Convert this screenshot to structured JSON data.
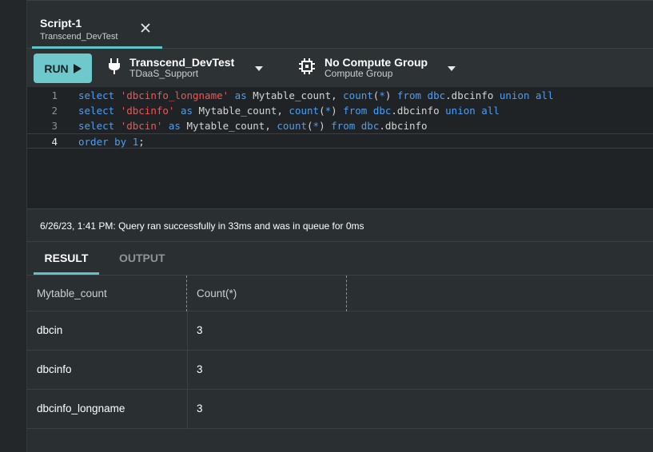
{
  "tab": {
    "title": "Script-1",
    "subtitle": "Transcend_DevTest",
    "close_icon": "close-icon"
  },
  "toolbar": {
    "run_label": "RUN",
    "connection": {
      "name": "Transcend_DevTest",
      "sub": "TDaaS_Support",
      "icon": "plug-icon"
    },
    "compute": {
      "name": "No Compute Group",
      "sub": "Compute Group",
      "icon": "chip-icon"
    }
  },
  "editor": {
    "lines": [
      {
        "num": "1",
        "tokens": [
          [
            "kw",
            "select "
          ],
          [
            "str",
            "'dbcinfo_longname'"
          ],
          [
            "kw",
            " as "
          ],
          [
            "plain",
            "Mytable_count, "
          ],
          [
            "kw",
            "count"
          ],
          [
            "plain",
            "("
          ],
          [
            "kw",
            "*"
          ],
          [
            "plain",
            ") "
          ],
          [
            "kw",
            "from "
          ],
          [
            "kw",
            "dbc"
          ],
          [
            "plain",
            ".dbcinfo "
          ],
          [
            "kw",
            "union all"
          ]
        ]
      },
      {
        "num": "2",
        "tokens": [
          [
            "kw",
            "select "
          ],
          [
            "str",
            "'dbcinfo'"
          ],
          [
            "kw",
            " as "
          ],
          [
            "plain",
            "Mytable_count, "
          ],
          [
            "kw",
            "count"
          ],
          [
            "plain",
            "("
          ],
          [
            "kw",
            "*"
          ],
          [
            "plain",
            ") "
          ],
          [
            "kw",
            "from "
          ],
          [
            "kw",
            "dbc"
          ],
          [
            "plain",
            ".dbcinfo "
          ],
          [
            "kw",
            "union all"
          ]
        ]
      },
      {
        "num": "3",
        "tokens": [
          [
            "kw",
            "select "
          ],
          [
            "str",
            "'dbcin'"
          ],
          [
            "kw",
            " as "
          ],
          [
            "plain",
            "Mytable_count, "
          ],
          [
            "kw",
            "count"
          ],
          [
            "plain",
            "("
          ],
          [
            "kw",
            "*"
          ],
          [
            "plain",
            ") "
          ],
          [
            "kw",
            "from "
          ],
          [
            "kw",
            "dbc"
          ],
          [
            "plain",
            ".dbcinfo"
          ]
        ]
      },
      {
        "num": "4",
        "tokens": [
          [
            "kw",
            "order by "
          ],
          [
            "kw",
            "1"
          ],
          [
            "plain",
            ";"
          ]
        ]
      }
    ]
  },
  "status": {
    "message": "6/26/23, 1:41 PM: Query ran successfully in 33ms and was in queue for 0ms"
  },
  "result_tabs": {
    "result": "RESULT",
    "output": "OUTPUT"
  },
  "grid": {
    "columns": [
      "Mytable_count",
      "Count(*)"
    ],
    "rows": [
      [
        "dbcin",
        "3"
      ],
      [
        "dbcinfo",
        "3"
      ],
      [
        "dbcinfo_longname",
        "3"
      ]
    ]
  },
  "colors": {
    "accent": "#6fc9cc",
    "keyword": "#4a9ff5",
    "string": "#f25454"
  }
}
